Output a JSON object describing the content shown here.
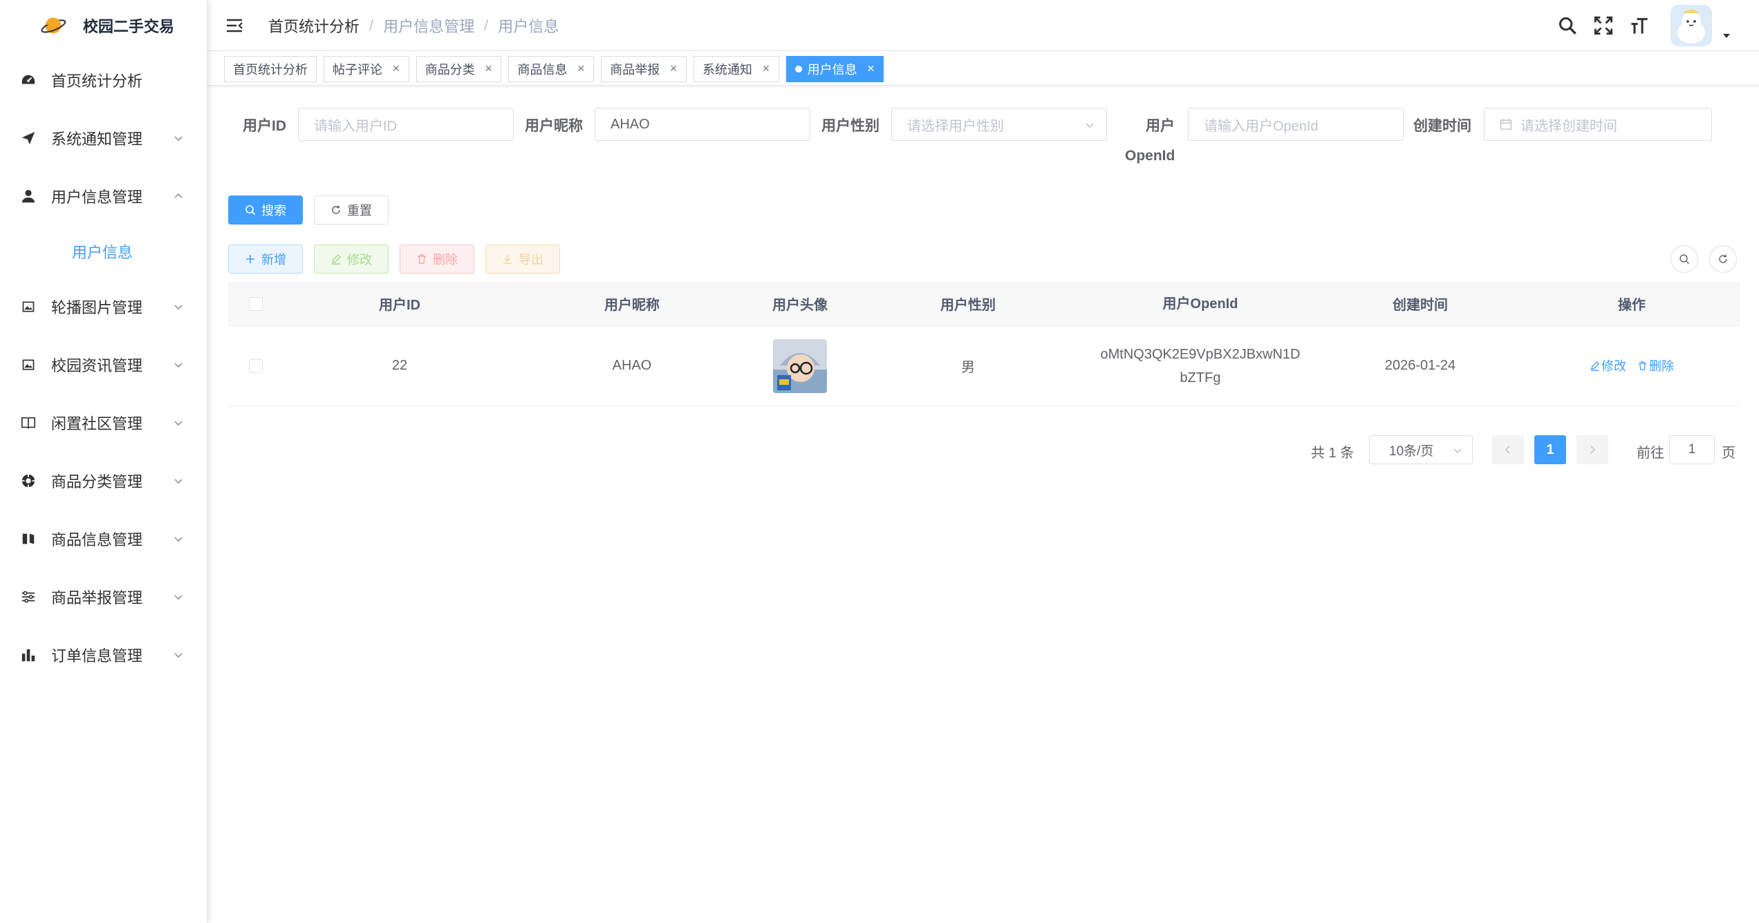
{
  "app": {
    "title": "校园二手交易"
  },
  "sidebar": {
    "items": [
      {
        "label": "首页统计分析",
        "icon": "dashboard-icon"
      },
      {
        "label": "系统通知管理",
        "icon": "send-icon"
      },
      {
        "label": "用户信息管理",
        "icon": "user-icon",
        "expanded": true
      },
      {
        "label": "轮播图片管理",
        "icon": "image-icon"
      },
      {
        "label": "校园资讯管理",
        "icon": "image-icon"
      },
      {
        "label": "闲置社区管理",
        "icon": "book-icon"
      },
      {
        "label": "商品分类管理",
        "icon": "category-icon"
      },
      {
        "label": "商品信息管理",
        "icon": "book-icon"
      },
      {
        "label": "商品举报管理",
        "icon": "sliders-icon"
      },
      {
        "label": "订单信息管理",
        "icon": "bar-chart-icon"
      }
    ],
    "submenu": {
      "label": "用户信息"
    }
  },
  "header": {
    "breadcrumb": [
      "首页统计分析",
      "用户信息管理",
      "用户信息"
    ]
  },
  "tags": [
    {
      "label": "首页统计分析",
      "closable": false
    },
    {
      "label": "帖子评论",
      "closable": true
    },
    {
      "label": "商品分类",
      "closable": true
    },
    {
      "label": "商品信息",
      "closable": true
    },
    {
      "label": "商品举报",
      "closable": true
    },
    {
      "label": "系统通知",
      "closable": true
    },
    {
      "label": "用户信息",
      "closable": true,
      "active": true
    }
  ],
  "search": {
    "user_id": {
      "label": "用户ID",
      "placeholder": "请输入用户ID",
      "value": ""
    },
    "nickname": {
      "label": "用户昵称",
      "value": "AHAO"
    },
    "gender": {
      "label": "用户性别",
      "placeholder": "请选择用户性别"
    },
    "openid": {
      "label_line1": "用户",
      "label_line2": "OpenId",
      "placeholder": "请输入用户OpenId"
    },
    "created": {
      "label": "创建时间",
      "placeholder": "请选择创建时间"
    },
    "search_button": "搜索",
    "reset_button": "重置"
  },
  "toolbar": {
    "add": "新增",
    "edit": "修改",
    "delete": "删除",
    "export": "导出"
  },
  "table": {
    "columns": [
      "用户ID",
      "用户昵称",
      "用户头像",
      "用户性别",
      "用户OpenId",
      "创建时间",
      "操作"
    ],
    "rows": [
      {
        "id": "22",
        "nickname": "AHAO",
        "gender": "男",
        "openid_line1": "oMtNQ3QK2E9VpBX2JBxwN1D",
        "openid_line2": "bZTFg",
        "created": "2026-01-24",
        "edit": "修改",
        "delete": "删除"
      }
    ]
  },
  "pagination": {
    "total": "共 1 条",
    "page_size": "10条/页",
    "current": "1",
    "goto_prefix": "前往",
    "goto_value": "1",
    "goto_suffix": "页"
  },
  "colors": {
    "primary": "#409eff",
    "sidebar_bg": "#ffffff",
    "text": "#303133"
  }
}
